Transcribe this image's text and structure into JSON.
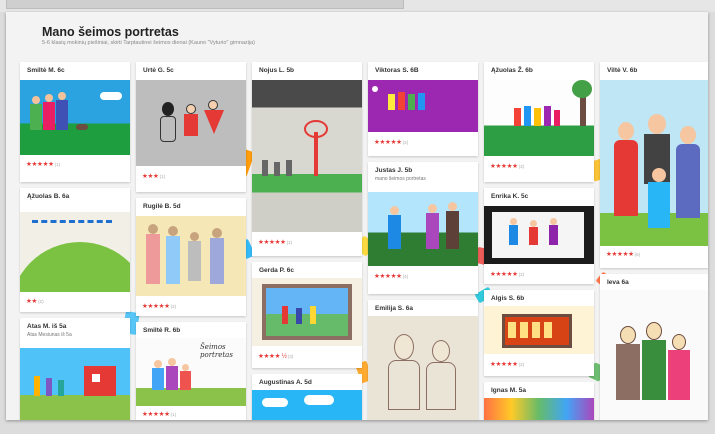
{
  "header": {
    "title": "Mano šeimos portretas",
    "subtitle": "5-6 klasių mokinių piešiniai, skirti Tarptautinei šeimos dienai (Kauno \"Vyturio\" gimnazija)"
  },
  "cards": [
    {
      "name": "Smiltė M. 6c",
      "rating": "★★★★★",
      "count": "(1)"
    },
    {
      "name": "Urtė G. 5c",
      "rating": "★★★",
      "count": "(1)"
    },
    {
      "name": "Nojus L. 5b",
      "rating": "★★★★★",
      "count": "(1)"
    },
    {
      "name": "Viktoras S. 6B",
      "rating": "★★★★★",
      "count": "(2)"
    },
    {
      "name": "Ąžuolas Ž. 6b",
      "rating": "★★★★★",
      "count": "(3)"
    },
    {
      "name": "Viltė V. 6b",
      "rating": "★★★★★",
      "count": "(6)"
    },
    {
      "name": "Ąžuolas B. 6a",
      "rating": "★★",
      "count": "(2)"
    },
    {
      "name": "Rugilė B. 5d",
      "rating": "★★★★★",
      "count": "(2)"
    },
    {
      "name": "Justas J. 5b",
      "desc": "mano šeimos portretas",
      "rating": "★★★★★",
      "count": "(4)"
    },
    {
      "name": "Enrika K. 5c",
      "rating": "★★★★★",
      "count": "(2)"
    },
    {
      "name": "Gerda P. 6c",
      "rating": "★★★★ ½",
      "count": "(3)"
    },
    {
      "name": "Atas M. iš 5a",
      "desc": "Atas Mesiunas iš 5a"
    },
    {
      "name": "Smiltė R. 6b",
      "rating": "★★★★★",
      "count": "(1)"
    },
    {
      "name": "Emilija S. 6a"
    },
    {
      "name": "Algis S. 6b",
      "rating": "★★★★★",
      "count": "(2)"
    },
    {
      "name": "Ieva 6a"
    },
    {
      "name": "Augustinas A. 5d"
    },
    {
      "name": "Ignas M. 5a"
    }
  ],
  "artwork": {
    "handwritten_caption": "Šeimos portretas"
  },
  "colors": {
    "star": "#e53935",
    "panel": "#f3f3f3",
    "card": "#ffffff"
  }
}
